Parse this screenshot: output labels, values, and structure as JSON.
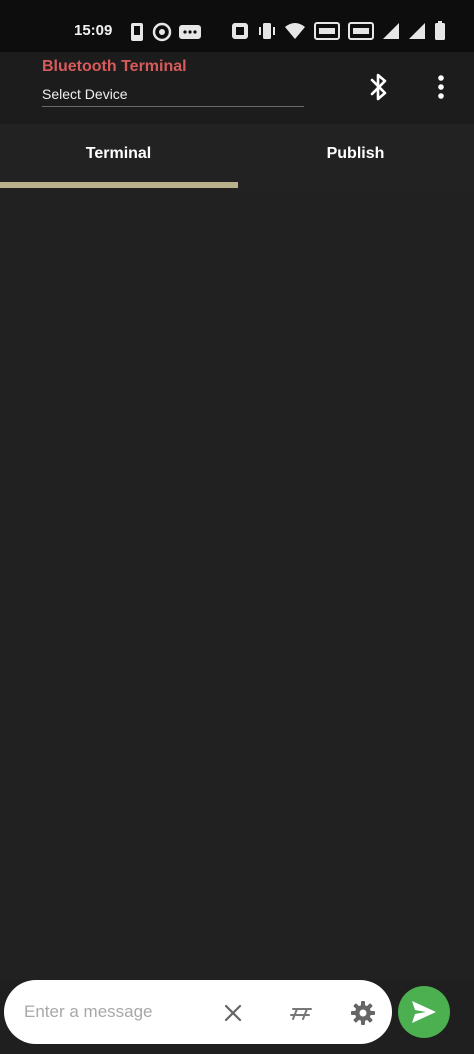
{
  "status_bar": {
    "time": "15:09"
  },
  "app_bar": {
    "title": "Bluetooth Terminal",
    "device_select_label": "Select Device"
  },
  "tabs": [
    {
      "label": "Terminal",
      "selected": true
    },
    {
      "label": "Publish",
      "selected": false
    }
  ],
  "input_bar": {
    "placeholder": "Enter a message"
  },
  "colors": {
    "title_red": "#d85a5a",
    "tab_indicator": "#b9b08c",
    "send_green": "#4caf50",
    "background": "#212121"
  },
  "icons": {
    "bluetooth": "bluetooth-icon",
    "menu": "more-vert-icon",
    "clear": "close-icon",
    "format": "format-icon",
    "settings": "gear-icon",
    "send": "send-icon"
  }
}
